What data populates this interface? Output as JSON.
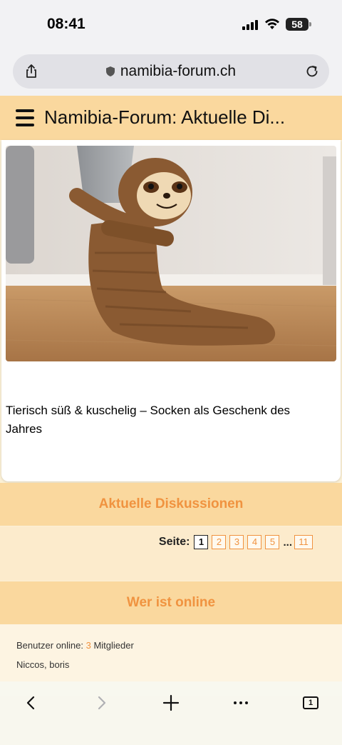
{
  "status_bar": {
    "time": "08:41",
    "battery": "58"
  },
  "browser": {
    "url": "namibia-forum.ch"
  },
  "site_header": {
    "title": "Namibia-Forum: Aktuelle Di..."
  },
  "article": {
    "title": "Tierisch süß & kuschelig – Socken als Geschenk des Jahres"
  },
  "discussions": {
    "heading": "Aktuelle Diskussionen",
    "pager_label": "Seite:",
    "pages": [
      "1",
      "2",
      "3",
      "4",
      "5"
    ],
    "ellipsis": "...",
    "last_page": "11"
  },
  "online": {
    "heading": "Wer ist online",
    "prefix": "Benutzer online:",
    "count": "3",
    "suffix": "Mitglieder",
    "members": "Niccos, boris"
  },
  "toolbar": {
    "tab_count": "1"
  }
}
